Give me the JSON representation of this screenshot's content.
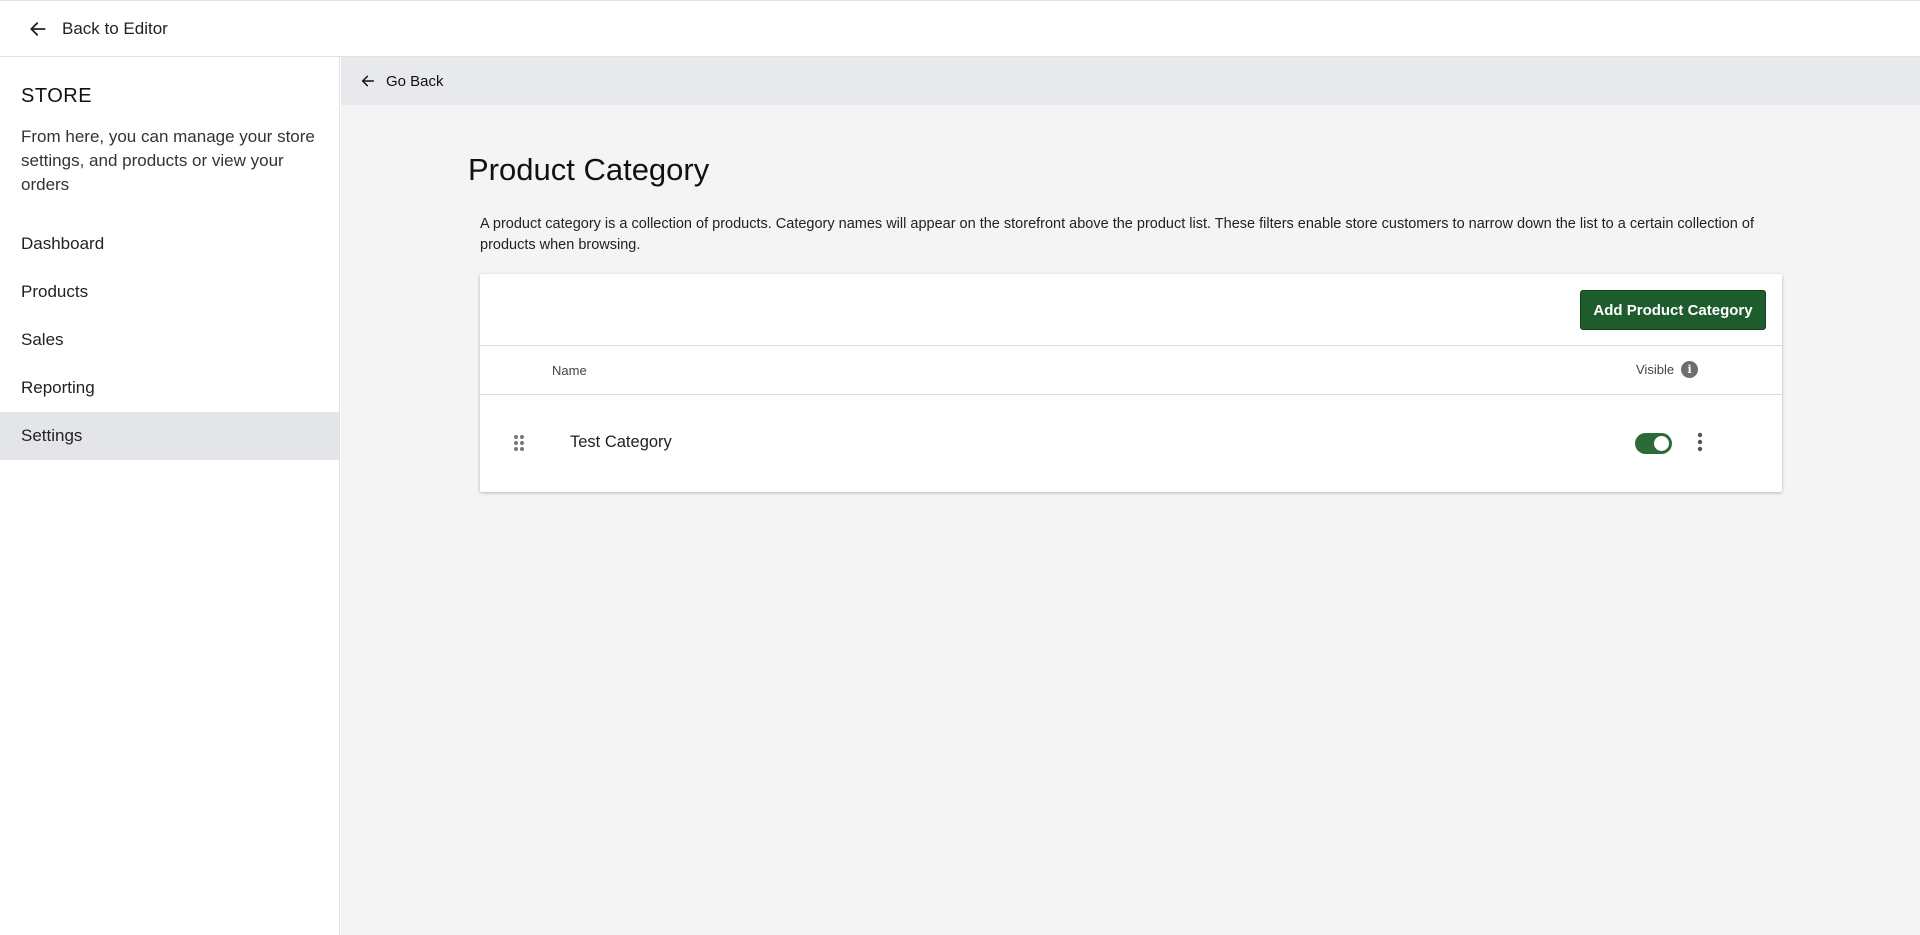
{
  "topbar": {
    "back_label": "Back to Editor"
  },
  "sidebar": {
    "title": "STORE",
    "description": "From here, you can manage your store settings, and products or view your orders",
    "items": [
      {
        "label": "Dashboard",
        "active": false
      },
      {
        "label": "Products",
        "active": false
      },
      {
        "label": "Sales",
        "active": false
      },
      {
        "label": "Reporting",
        "active": false
      },
      {
        "label": "Settings",
        "active": true
      }
    ]
  },
  "main": {
    "go_back_label": "Go Back",
    "title": "Product Category",
    "description": "A product category is a collection of products. Category names will appear on the storefront above the product list. These filters enable store customers to narrow down the list to a certain collection of products when browsing.",
    "add_button_label": "Add Product Category",
    "table": {
      "columns": {
        "name": "Name",
        "visible": "Visible"
      },
      "rows": [
        {
          "name": "Test Category",
          "visible": true
        }
      ]
    }
  },
  "colors": {
    "accent": "#1e5c2e",
    "toggle_on": "#2c6b37",
    "sidebar_active": "#e4e5e9",
    "main_bg": "#f4f4f4"
  },
  "icons": {
    "back": "arrow-left-icon",
    "info": "info-icon",
    "drag": "drag-handle-icon",
    "more": "more-vertical-icon"
  }
}
